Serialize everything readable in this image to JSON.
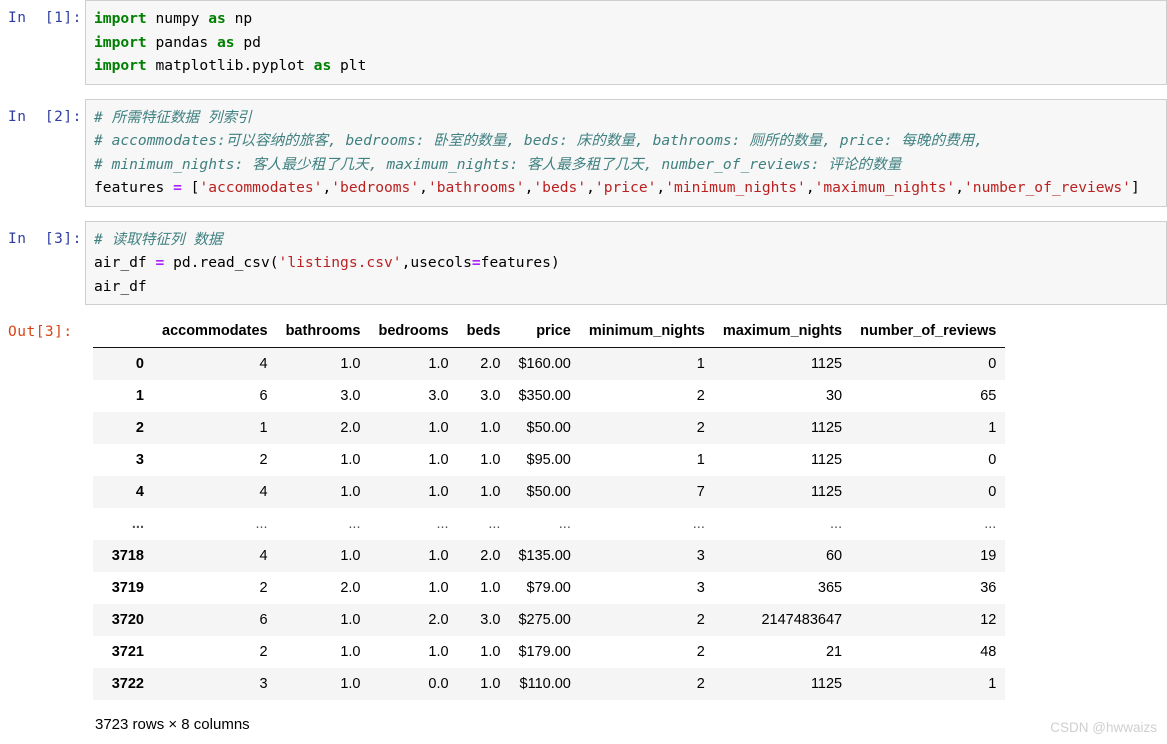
{
  "cells": [
    {
      "prompt": "In  [1]:",
      "lines": [
        [
          {
            "t": "import",
            "c": "kw"
          },
          {
            "t": " numpy ",
            "c": "fn"
          },
          {
            "t": "as",
            "c": "kw"
          },
          {
            "t": " np",
            "c": "fn"
          }
        ],
        [
          {
            "t": "import",
            "c": "kw"
          },
          {
            "t": " pandas ",
            "c": "fn"
          },
          {
            "t": "as",
            "c": "kw"
          },
          {
            "t": " pd",
            "c": "fn"
          }
        ],
        [
          {
            "t": "import",
            "c": "kw"
          },
          {
            "t": " matplotlib.pyplot ",
            "c": "fn"
          },
          {
            "t": "as",
            "c": "kw"
          },
          {
            "t": " plt",
            "c": "fn"
          }
        ]
      ]
    },
    {
      "prompt": "In  [2]:",
      "lines": [
        [
          {
            "t": "# 所需特征数据 列索引",
            "c": "cmt"
          }
        ],
        [
          {
            "t": "# accommodates:可以容纳的旅客, bedrooms: 卧室的数量, beds: 床的数量, bathrooms: 厕所的数量, price: 每晚的费用,",
            "c": "cmt"
          }
        ],
        [
          {
            "t": "# minimum_nights: 客人最少租了几天, maximum_nights: 客人最多租了几天, number_of_reviews: 评论的数量",
            "c": "cmt"
          }
        ],
        [
          {
            "t": "features ",
            "c": "fn"
          },
          {
            "t": "=",
            "c": "op"
          },
          {
            "t": " [",
            "c": "fn"
          },
          {
            "t": "'accommodates'",
            "c": "str"
          },
          {
            "t": ",",
            "c": "fn"
          },
          {
            "t": "'bedrooms'",
            "c": "str"
          },
          {
            "t": ",",
            "c": "fn"
          },
          {
            "t": "'bathrooms'",
            "c": "str"
          },
          {
            "t": ",",
            "c": "fn"
          },
          {
            "t": "'beds'",
            "c": "str"
          },
          {
            "t": ",",
            "c": "fn"
          },
          {
            "t": "'price'",
            "c": "str"
          },
          {
            "t": ",",
            "c": "fn"
          },
          {
            "t": "'minimum_nights'",
            "c": "str"
          },
          {
            "t": ",",
            "c": "fn"
          },
          {
            "t": "'maximum_nights'",
            "c": "str"
          },
          {
            "t": ",",
            "c": "fn"
          },
          {
            "t": "'number_of_reviews'",
            "c": "str"
          },
          {
            "t": "]",
            "c": "fn"
          }
        ]
      ]
    },
    {
      "prompt": "In  [3]:",
      "lines": [
        [
          {
            "t": "# 读取特征列 数据",
            "c": "cmt"
          }
        ],
        [
          {
            "t": "air_df ",
            "c": "fn"
          },
          {
            "t": "=",
            "c": "op"
          },
          {
            "t": " pd.read_csv(",
            "c": "fn"
          },
          {
            "t": "'listings.csv'",
            "c": "str"
          },
          {
            "t": ",usecols",
            "c": "fn"
          },
          {
            "t": "=",
            "c": "op"
          },
          {
            "t": "features)",
            "c": "fn"
          }
        ],
        [
          {
            "t": "air_df",
            "c": "fn"
          }
        ]
      ]
    }
  ],
  "output": {
    "prompt": "Out[3]:",
    "index_header": "",
    "columns": [
      "accommodates",
      "bathrooms",
      "bedrooms",
      "beds",
      "price",
      "minimum_nights",
      "maximum_nights",
      "number_of_reviews"
    ],
    "rows": [
      {
        "index": "0",
        "values": [
          "4",
          "1.0",
          "1.0",
          "2.0",
          "$160.00",
          "1",
          "1125",
          "0"
        ]
      },
      {
        "index": "1",
        "values": [
          "6",
          "3.0",
          "3.0",
          "3.0",
          "$350.00",
          "2",
          "30",
          "65"
        ]
      },
      {
        "index": "2",
        "values": [
          "1",
          "2.0",
          "1.0",
          "1.0",
          "$50.00",
          "2",
          "1125",
          "1"
        ]
      },
      {
        "index": "3",
        "values": [
          "2",
          "1.0",
          "1.0",
          "1.0",
          "$95.00",
          "1",
          "1125",
          "0"
        ]
      },
      {
        "index": "4",
        "values": [
          "4",
          "1.0",
          "1.0",
          "1.0",
          "$50.00",
          "7",
          "1125",
          "0"
        ]
      },
      {
        "index": "...",
        "values": [
          "...",
          "...",
          "...",
          "...",
          "...",
          "...",
          "...",
          "..."
        ],
        "ellipsis": true
      },
      {
        "index": "3718",
        "values": [
          "4",
          "1.0",
          "1.0",
          "2.0",
          "$135.00",
          "3",
          "60",
          "19"
        ]
      },
      {
        "index": "3719",
        "values": [
          "2",
          "2.0",
          "1.0",
          "1.0",
          "$79.00",
          "3",
          "365",
          "36"
        ]
      },
      {
        "index": "3720",
        "values": [
          "6",
          "1.0",
          "2.0",
          "3.0",
          "$275.00",
          "2",
          "2147483647",
          "12"
        ]
      },
      {
        "index": "3721",
        "values": [
          "2",
          "1.0",
          "1.0",
          "1.0",
          "$179.00",
          "2",
          "21",
          "48"
        ]
      },
      {
        "index": "3722",
        "values": [
          "3",
          "1.0",
          "0.0",
          "1.0",
          "$110.00",
          "2",
          "1125",
          "1"
        ]
      }
    ],
    "shape_text": "3723 rows × 8 columns"
  },
  "watermark": "CSDN @hwwaizs",
  "colors": {
    "prompt_in": "#303F9F",
    "prompt_out": "#D84315",
    "keyword": "#008000",
    "string": "#BA2121",
    "operator": "#AA22FF",
    "comment": "#408080",
    "cell_bg": "#f7f7f7",
    "cell_border": "#cfcfcf",
    "row_stripe": "#f5f5f5",
    "watermark": "#cfcfcf"
  }
}
